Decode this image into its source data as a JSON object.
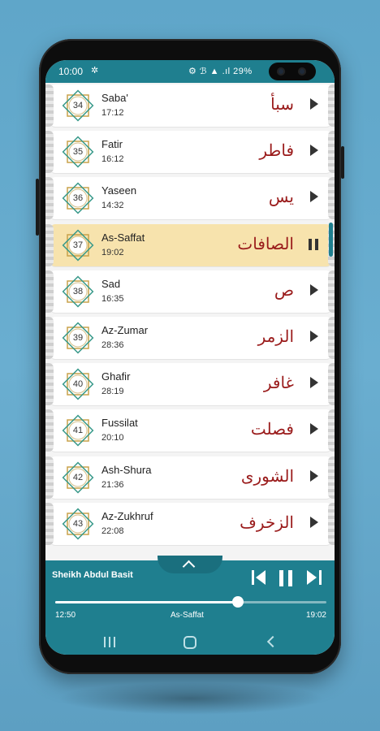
{
  "status": {
    "time": "10:00",
    "icons": "⚙ ℬ ▲ .ıl  29%"
  },
  "surahs": [
    {
      "num": "34",
      "name": "Saba'",
      "duration": "17:12",
      "arabic": "سبأ",
      "active": false
    },
    {
      "num": "35",
      "name": "Fatir",
      "duration": "16:12",
      "arabic": "فاطر",
      "active": false
    },
    {
      "num": "36",
      "name": "Yaseen",
      "duration": "14:32",
      "arabic": "يس",
      "active": false
    },
    {
      "num": "37",
      "name": "As-Saffat",
      "duration": "19:02",
      "arabic": "الصافات",
      "active": true
    },
    {
      "num": "38",
      "name": "Sad",
      "duration": "16:35",
      "arabic": "ص",
      "active": false
    },
    {
      "num": "39",
      "name": "Az-Zumar",
      "duration": "28:36",
      "arabic": "الزمر",
      "active": false
    },
    {
      "num": "40",
      "name": "Ghafir",
      "duration": "28:19",
      "arabic": "غافر",
      "active": false
    },
    {
      "num": "41",
      "name": "Fussilat",
      "duration": "20:10",
      "arabic": "فصلت",
      "active": false
    },
    {
      "num": "42",
      "name": "Ash-Shura",
      "duration": "21:36",
      "arabic": "الشورى",
      "active": false
    },
    {
      "num": "43",
      "name": "Az-Zukhruf",
      "duration": "22:08",
      "arabic": "الزخرف",
      "active": false
    }
  ],
  "player": {
    "reciter": "Sheikh Abdul Basit",
    "current_time": "12:50",
    "current_surah": "As-Saffat",
    "total_time": "19:02",
    "progress": 0.673
  },
  "colors": {
    "accent": "#1f7f8f",
    "active_row": "#f7e3ad",
    "arabic_text": "#9a1b1b"
  }
}
